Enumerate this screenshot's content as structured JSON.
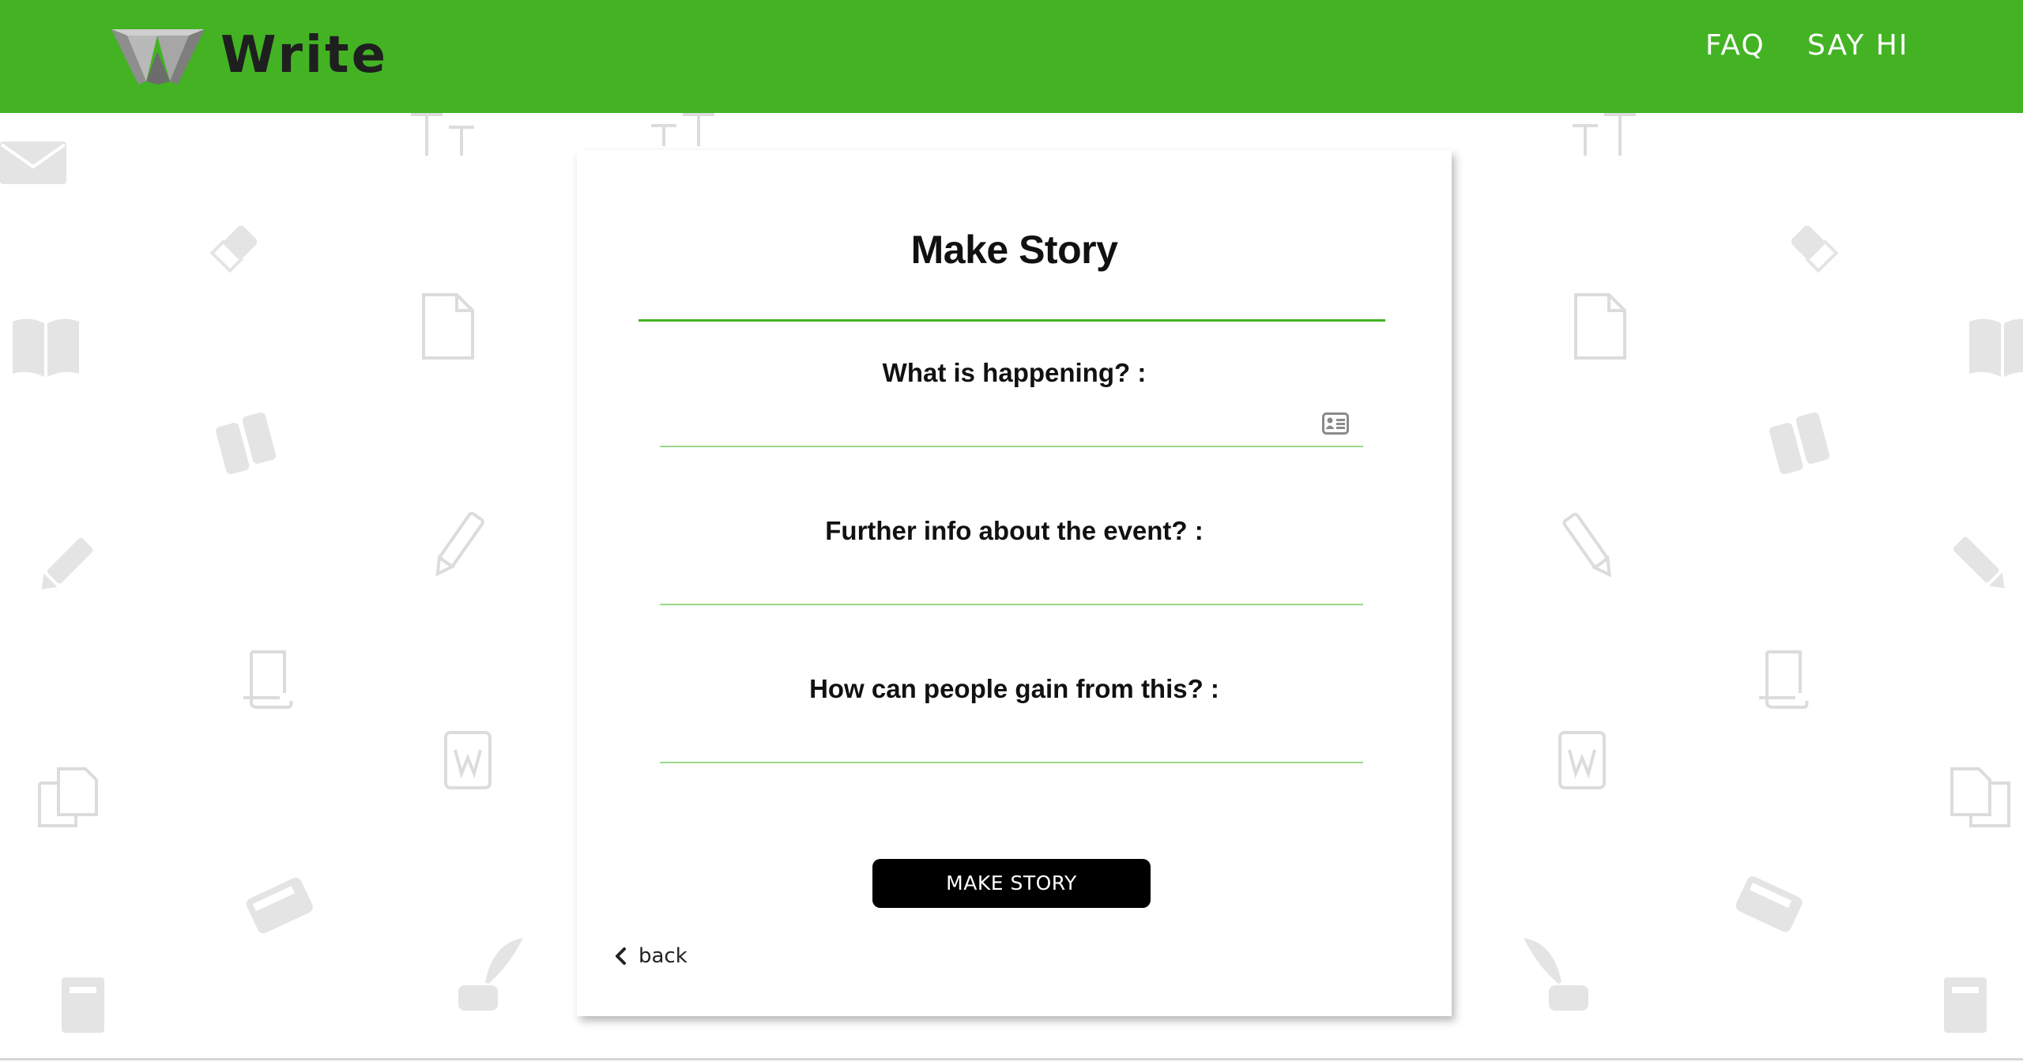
{
  "app": {
    "brand": "Write",
    "colors": {
      "accent": "#43b324",
      "button": "#000000",
      "underline": "#9cd98a"
    }
  },
  "nav": {
    "faq": "FAQ",
    "say_hi": "SAY HI"
  },
  "form": {
    "title": "Make Story",
    "fields": [
      {
        "label": "What is happening? :",
        "value": "",
        "icon": "contact-card-icon"
      },
      {
        "label": "Further info about the event? :",
        "value": ""
      },
      {
        "label": "How can people gain from this? :",
        "value": ""
      }
    ],
    "submit_label": "MAKE STORY",
    "back_label": "back"
  }
}
